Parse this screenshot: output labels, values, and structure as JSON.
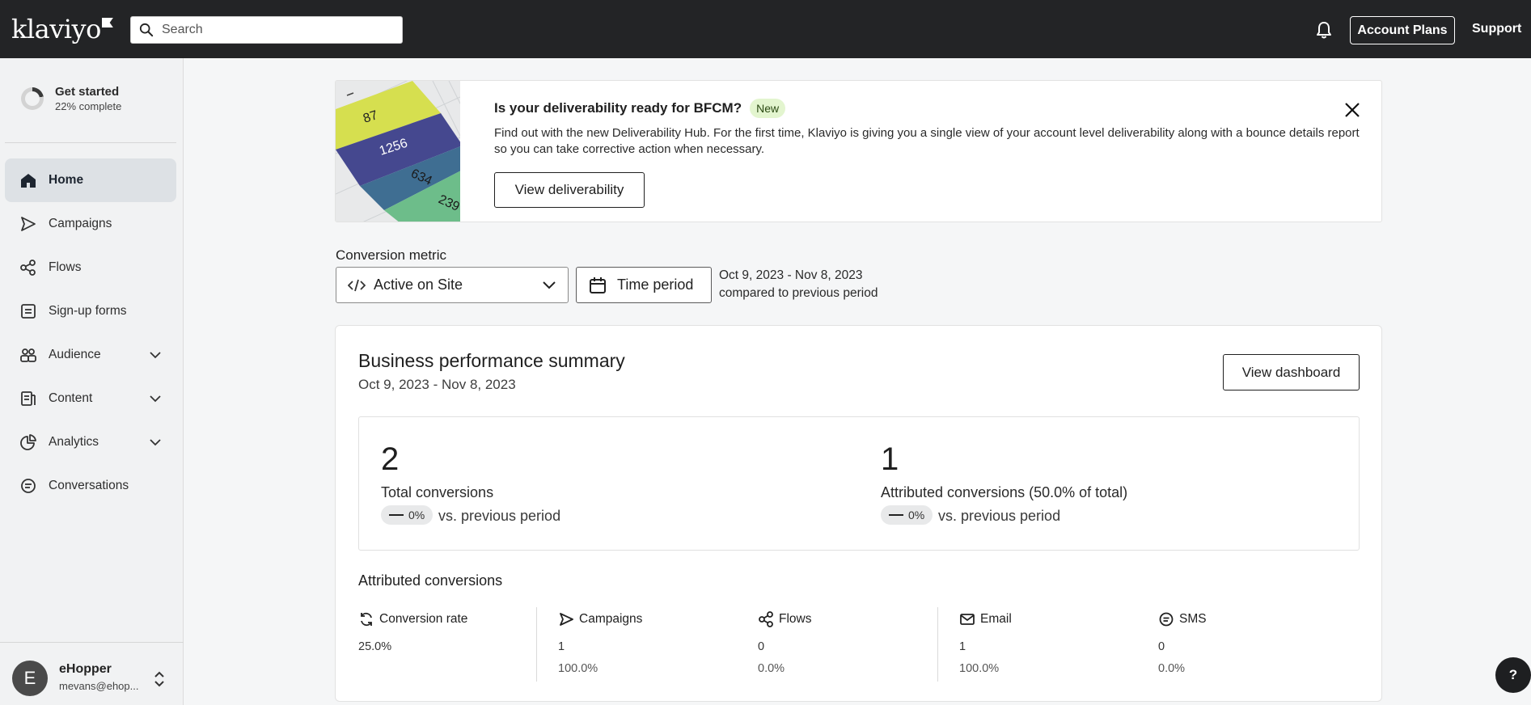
{
  "topbar": {
    "logo": "klaviyo",
    "search_placeholder": "Search",
    "account_plans": "Account Plans",
    "support": "Support"
  },
  "sidebar": {
    "get_started": {
      "title": "Get started",
      "progress_text": "22% complete",
      "progress": 0.22
    },
    "items": [
      {
        "label": "Home",
        "icon": "home-icon",
        "active": true
      },
      {
        "label": "Campaigns",
        "icon": "send-icon"
      },
      {
        "label": "Flows",
        "icon": "flows-icon"
      },
      {
        "label": "Sign-up forms",
        "icon": "form-icon"
      },
      {
        "label": "Audience",
        "icon": "audience-icon",
        "expandable": true
      },
      {
        "label": "Content",
        "icon": "content-icon",
        "expandable": true
      },
      {
        "label": "Analytics",
        "icon": "analytics-icon",
        "expandable": true
      },
      {
        "label": "Conversations",
        "icon": "chat-icon"
      }
    ],
    "user": {
      "initial": "E",
      "name": "eHopper",
      "email": "mevans@ehop..."
    }
  },
  "banner": {
    "title": "Is your deliverability ready for BFCM?",
    "badge": "New",
    "description": "Find out with the new Deliverability Hub. For the first time, Klaviyo is giving you a single view of your account level deliverability along with a bounce details report so you can take corrective action when necessary.",
    "button": "View deliverability",
    "image_numbers": [
      "87",
      "1256",
      "634",
      "239"
    ]
  },
  "filters": {
    "metric_label": "Conversion metric",
    "metric_value": "Active on Site",
    "time_button": "Time period",
    "range": "Oct 9, 2023 - Nov 8, 2023",
    "compare": "compared to previous period"
  },
  "summary": {
    "title": "Business performance summary",
    "date": "Oct 9, 2023 - Nov 8, 2023",
    "dashboard_button": "View dashboard",
    "stats": [
      {
        "value": "2",
        "label": "Total conversions",
        "change": "0%",
        "vs": "vs. previous period"
      },
      {
        "value": "1",
        "label": "Attributed conversions (50.0% of total)",
        "change": "0%",
        "vs": "vs. previous period"
      }
    ],
    "attributed_title": "Attributed conversions",
    "attributed": [
      {
        "label": "Conversion rate",
        "icon": "refresh-icon",
        "v1": "25.0%",
        "v2": ""
      },
      {
        "label": "Campaigns",
        "icon": "send-icon",
        "v1": "1",
        "v2": "100.0%"
      },
      {
        "label": "Flows",
        "icon": "flows-icon",
        "v1": "0",
        "v2": "0.0%"
      },
      {
        "label": "Email",
        "icon": "mail-icon",
        "v1": "1",
        "v2": "100.0%"
      },
      {
        "label": "SMS",
        "icon": "sms-icon",
        "v1": "0",
        "v2": "0.0%"
      }
    ]
  },
  "help": "?"
}
